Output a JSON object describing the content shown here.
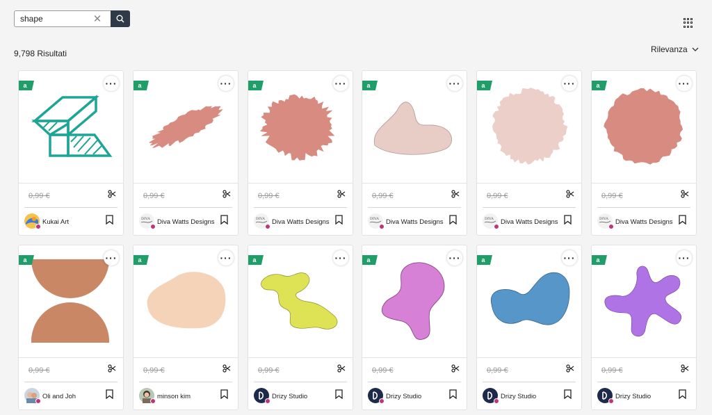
{
  "search": {
    "value": "shape",
    "placeholder": ""
  },
  "results_label": "9,798 Risultati",
  "sort_label": "Rilevanza",
  "colors": {
    "badge": "#1f9e6a",
    "search_button": "#2f3a49",
    "member_dot": "#c0357a"
  },
  "cards": [
    {
      "price": "0,99 €",
      "designer": "Kukai Art",
      "shape": "teal-boxes-icon",
      "badge": "a"
    },
    {
      "price": "0,99 €",
      "designer": "Diva Watts Designs",
      "shape": "rough-strip-shape",
      "badge": "a"
    },
    {
      "price": "0,99 €",
      "designer": "Diva Watts Designs",
      "shape": "rough-blob-shape",
      "badge": "a"
    },
    {
      "price": "0,99 €",
      "designer": "Diva Watts Designs",
      "shape": "pale-blob-shape",
      "badge": "a"
    },
    {
      "price": "0,99 €",
      "designer": "Diva Watts Designs",
      "shape": "pale-rough-circle-shape",
      "badge": "a"
    },
    {
      "price": "0,99 €",
      "designer": "Diva Watts Designs",
      "shape": "rough-circle-shape",
      "badge": "a"
    },
    {
      "price": "0,99 €",
      "designer": "Oli and Joh",
      "shape": "hourglass-shape",
      "badge": "a"
    },
    {
      "price": "0,99 €",
      "designer": "minson kim",
      "shape": "peach-blob-shape",
      "badge": "a"
    },
    {
      "price": "0,99 €",
      "designer": "Drizy Studio",
      "shape": "yellow-squiggle-shape",
      "badge": "a"
    },
    {
      "price": "0,99 €",
      "designer": "Drizy Studio",
      "shape": "pink-blob-shape",
      "badge": "a"
    },
    {
      "price": "0,99 €",
      "designer": "Drizy Studio",
      "shape": "blue-blob-shape",
      "badge": "a"
    },
    {
      "price": "0,99 €",
      "designer": "Drizy Studio",
      "shape": "purple-splat-shape",
      "badge": "a"
    }
  ]
}
